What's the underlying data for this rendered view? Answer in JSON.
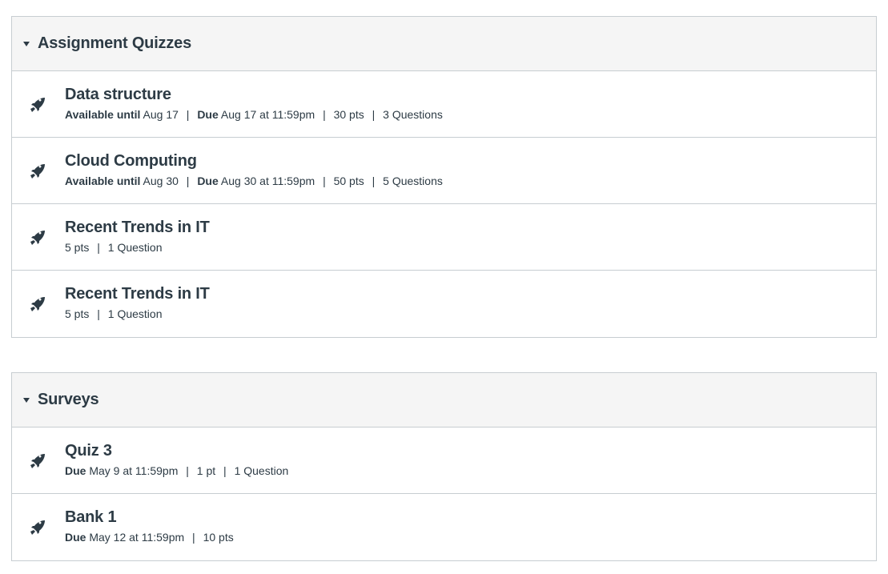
{
  "assignment_group": {
    "title": "Assignment Quizzes",
    "items": [
      {
        "title": "Data structure",
        "available_label": "Available until",
        "available_value": "Aug 17",
        "due_label": "Due",
        "due_value": "Aug 17 at 11:59pm",
        "points": "30 pts",
        "questions": "3 Questions"
      },
      {
        "title": "Cloud Computing",
        "available_label": "Available until",
        "available_value": "Aug 30",
        "due_label": "Due",
        "due_value": "Aug 30 at 11:59pm",
        "points": "50 pts",
        "questions": "5 Questions"
      },
      {
        "title": "Recent Trends in IT",
        "points": "5 pts",
        "questions": "1 Question"
      },
      {
        "title": "Recent Trends in IT",
        "points": "5 pts",
        "questions": "1 Question"
      }
    ]
  },
  "surveys_group": {
    "title": "Surveys",
    "items": [
      {
        "title": "Quiz 3",
        "due_label": "Due",
        "due_value": "May 9 at 11:59pm",
        "points": "1 pt",
        "questions": "1 Question"
      },
      {
        "title": "Bank 1",
        "due_label": "Due",
        "due_value": "May 12 at 11:59pm",
        "points": "10 pts"
      }
    ]
  },
  "separator": "|",
  "icons": {
    "collapse": "caret-down-icon",
    "quiz": "quiz-rocket-icon"
  },
  "colors": {
    "text": "#2d3b45",
    "header_bg": "#f5f5f5",
    "border": "#c7cdd1"
  }
}
